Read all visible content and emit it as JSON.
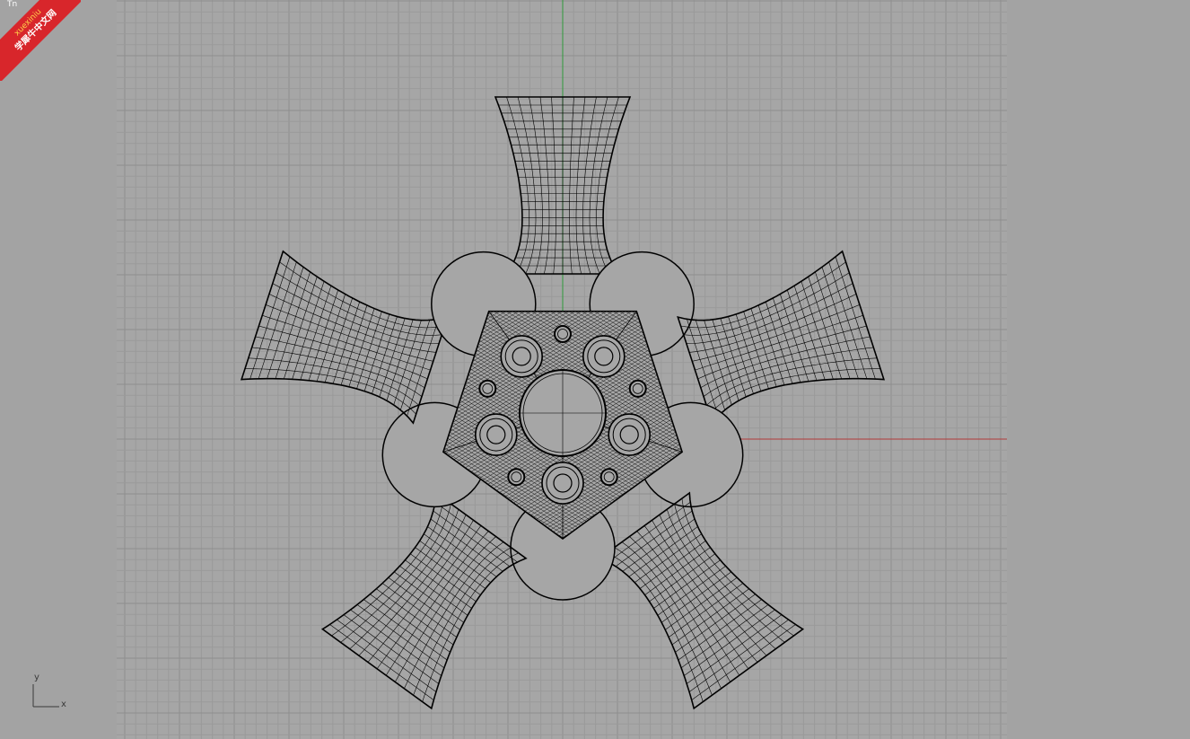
{
  "viewport": {
    "name": "Top",
    "background": "#a3a3a3",
    "grid_minor_color": "#9a9a9a",
    "grid_major_color": "#8e8e8e",
    "x_axis_color": "#b23a3a",
    "y_axis_color": "#2f9a3a",
    "wire_color": "#000000"
  },
  "axis_widget": {
    "x_label": "x",
    "y_label": "y"
  },
  "watermark": {
    "top": "Tn",
    "line1": "xuexiniu",
    "line2": "学犀牛中文网"
  },
  "model": {
    "type": "wheel-rim-wireframe",
    "spokes": 5,
    "lug_holes": 5,
    "small_holes": 5
  }
}
